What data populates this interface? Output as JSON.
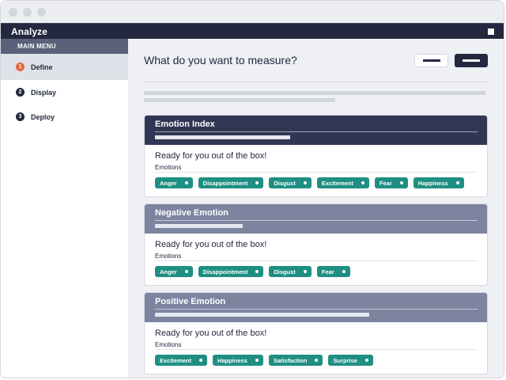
{
  "app": {
    "brand": "Analyze"
  },
  "sidebar": {
    "header": "MAIN MENU",
    "items": [
      {
        "step": "1",
        "label": "Define",
        "active": true
      },
      {
        "step": "2",
        "label": "Display",
        "active": false
      },
      {
        "step": "3",
        "label": "Deploy",
        "active": false
      }
    ]
  },
  "main": {
    "title": "What do you want to measure?",
    "cards": [
      {
        "title": "Emotion Index",
        "style": "dark",
        "description": "Ready for you out of the box!",
        "section": "Emotions",
        "tags": [
          "Anger",
          "Disappointment",
          "Disgust",
          "Excitement",
          "Fear",
          "Happiness"
        ]
      },
      {
        "title": "Negative Emotion",
        "style": "muted",
        "description": "Ready for you out of the box!",
        "section": "Emotions",
        "tags": [
          "Anger",
          "Disappointment",
          "Disgust",
          "Fear"
        ]
      },
      {
        "title": "Positive Emotion",
        "style": "muted",
        "description": "Ready for you out of the box!",
        "section": "Emotions",
        "tags": [
          "Excitement",
          "Happiness",
          "Satisfaction",
          "Surprise"
        ]
      }
    ]
  },
  "colors": {
    "navy": "#23283e",
    "accent_orange": "#e8663a",
    "tag_teal": "#1e8f82",
    "card_header_dark": "#303654",
    "card_header_muted": "#7c84a0"
  }
}
